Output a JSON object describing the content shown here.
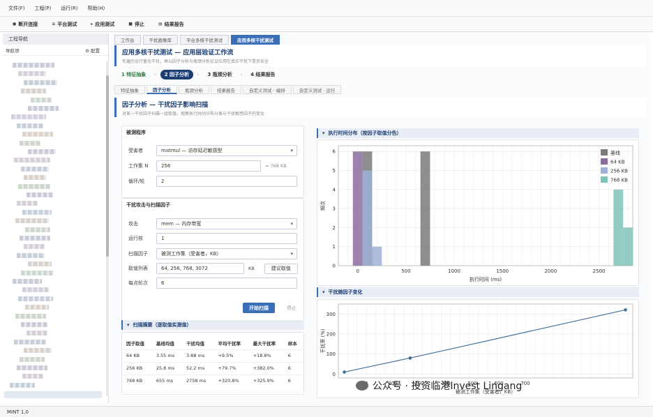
{
  "menu": [
    "文件(F)",
    "工程(P)",
    "运行(R)",
    "帮助(H)"
  ],
  "toolbar": [
    {
      "icon": "dot-icon",
      "label": "断开连接"
    },
    {
      "icon": "bars-icon",
      "label": "平台测试"
    },
    {
      "icon": "play-icon",
      "label": "应用测试"
    },
    {
      "icon": "stop-icon",
      "label": "停止"
    },
    {
      "icon": "doc-icon",
      "label": "结果报告"
    }
  ],
  "sidebar": {
    "title": "工程导航",
    "sub": "导航项",
    "config": "⚙ 配置"
  },
  "tabs": [
    "工作台",
    "干扰画像库",
    "平台多核干扰测试",
    "应用多核干扰测试"
  ],
  "header": {
    "title": "应用多核干扰测试 — 应用层验证工作流",
    "subtitle": "先遍历运行量化干扰，再以因子分析与瓶颈分析论证应用在真实干扰下是否安全"
  },
  "steps": [
    {
      "label": "1 特征抽象"
    },
    {
      "label": "2 因子分析"
    },
    {
      "label": "3 瓶颈分析"
    },
    {
      "label": "4 结果报告"
    }
  ],
  "subtabs": [
    "特征抽象",
    "因子分析",
    "瓶颈分析",
    "结果报告",
    "自定义测试 · 编排",
    "自定义测试 · 运行"
  ],
  "factor": {
    "title": "因子分析 — 干扰因子影响扫描",
    "subtitle": "对某一干扰因子扫描一组取值，观察执行时间分布分离与干扰敏感因子的变化"
  },
  "program": {
    "section": "被测程序",
    "victim_label": "受害者",
    "victim_value": "matmul — 访存延迟敏感型",
    "ws_label": "工作集 N",
    "ws_value": "256",
    "ws_hint": "≈ 768 KB",
    "loops_label": "循环/轮",
    "loops_value": "2"
  },
  "attack": {
    "section": "干扰攻击与扫描因子",
    "atk_label": "攻击",
    "atk_value": "mem — 内存带宽",
    "cores_label": "运行核",
    "cores_value": "1",
    "factor_label": "扫描因子",
    "factor_value": "被测工作集（受害者，KB）",
    "list_label": "取值列表",
    "list_value": "64, 256, 768, 3072",
    "list_unit": "KB",
    "suggest_btn": "建议取值",
    "rounds_label": "每点轮次",
    "rounds_value": "6"
  },
  "actions": {
    "start": "开始扫描",
    "stop": "停止"
  },
  "summary": {
    "title": "扫描摘要（逐取值实测值）",
    "headers": [
      "因子取值",
      "基线均值",
      "干扰均值",
      "平均干扰率",
      "最大干扰率",
      "样本"
    ],
    "rows": [
      [
        "64 KB",
        "3.55 ms",
        "3.88 ms",
        "+9.5%",
        "+18.8%",
        "6"
      ],
      [
        "256 KB",
        "25.8 ms",
        "52.2 ms",
        "+79.7%",
        "+382.0%",
        "6"
      ],
      [
        "768 KB",
        "655 ms",
        "2758 ms",
        "+320.8%",
        "+325.9%",
        "6"
      ]
    ]
  },
  "chart_data": [
    {
      "type": "bar",
      "title": "执行时间分布（按因子取值分色）",
      "xlabel": "执行时间 (ms)",
      "ylabel": "频次",
      "xlim": [
        -200,
        2850
      ],
      "ylim": [
        0,
        6.3
      ],
      "xticks": [
        0,
        500,
        1000,
        1500,
        2000,
        2500
      ],
      "yticks": [
        0,
        1,
        2,
        3,
        4,
        5,
        6
      ],
      "legend": "top-right",
      "series": [
        {
          "name": "基线",
          "color": "#7a7a7a",
          "bars": [
            {
              "x0": 50,
              "x1": 150,
              "y": 6
            },
            {
              "x0": 650,
              "x1": 750,
              "y": 6
            }
          ]
        },
        {
          "name": "64 KB",
          "color": "#8a6d9e",
          "bars": [
            {
              "x0": -50,
              "x1": 50,
              "y": 6
            }
          ]
        },
        {
          "name": "256 KB",
          "color": "#9fb0d6",
          "bars": [
            {
              "x0": 50,
              "x1": 150,
              "y": 5
            },
            {
              "x0": 150,
              "x1": 250,
              "y": 1
            }
          ]
        },
        {
          "name": "768 KB",
          "color": "#7fc3b8",
          "bars": [
            {
              "x0": 2650,
              "x1": 2750,
              "y": 4
            },
            {
              "x0": 2750,
              "x1": 2850,
              "y": 2
            }
          ]
        }
      ]
    },
    {
      "type": "line",
      "title": "干扰随因子变化",
      "xlabel": "被测工作集（受害者，KB）",
      "ylabel": "干扰率 (%)",
      "xlim": [
        0,
        3150
      ],
      "ylim": [
        -20,
        350
      ],
      "xticks": [
        0,
        200,
        300,
        400,
        500,
        600,
        700
      ],
      "yticks": [
        0,
        100,
        200,
        300
      ],
      "x": [
        64,
        768,
        3072
      ],
      "y": [
        9.5,
        79.7,
        320.8
      ]
    }
  ],
  "watermark": "公众号 · 投资临港Invest Lingang",
  "status": "MINT 1.0",
  "colors": {
    "accent": "#3a6fb8",
    "dark": "#1d3d72",
    "green": "#2d7a3a"
  }
}
